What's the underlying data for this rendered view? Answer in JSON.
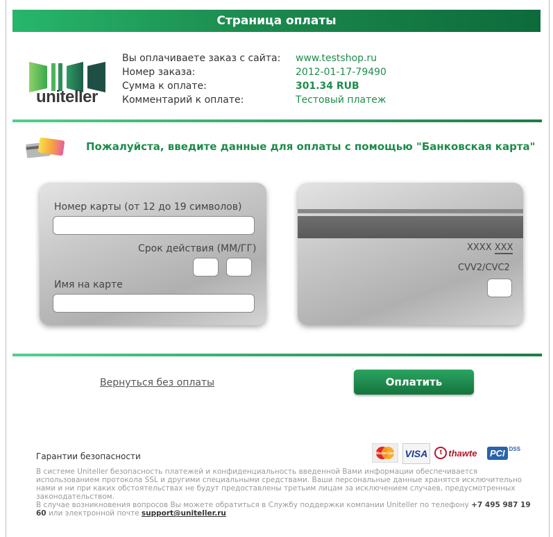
{
  "header": {
    "title": "Страница оплаты"
  },
  "logo": {
    "text": "uniteller"
  },
  "order": {
    "site_label": "Вы оплачиваете заказ с сайта:",
    "site_value": "www.testshop.ru",
    "number_label": "Номер заказа:",
    "number_value": "2012-01-17-79490",
    "amount_label": "Сумма к оплате:",
    "amount_value": "301.34 RUB",
    "comment_label": "Комментарий к оплате:",
    "comment_value": "Тестовый платеж"
  },
  "prompt": "Пожалуйста, введите данные для оплаты с помощью \"Банковская карта\"",
  "card_front": {
    "number_label": "Номер карты (от 12 до 19 символов)",
    "expiry_label": "Срок действия (ММ/ГГ)",
    "name_label": "Имя на карте"
  },
  "card_back": {
    "masked_prefix": "XXXX",
    "masked_suffix": "XXX",
    "cvv_label": "CVV2/CVC2"
  },
  "actions": {
    "back_label": "Вернуться без оплаты",
    "pay_label": "Оплатить"
  },
  "security": {
    "title": "Гарантии безопасности",
    "text1": "В системе Uniteller безопасность платежей и конфиденциальность введенной Вами информации обеспечивается использованием протокола SSL и другими специальными средствами. Ваши персональные данные хранятся исключительно нами и ни при каких обстоятельствах не будут предоставлены третьим лицам за исключением случаев, предусмотренных законодательством.",
    "text2_before": "В случае возникновения вопросов Вы можете обратиться в Службу поддержки компании Uniteller по телефону",
    "phone": "+7 495 987 19 60",
    "text2_middle": "или электронной почте",
    "email": "support@uniteller.ru"
  },
  "badges": {
    "mastercard": "MasterCard",
    "visa": "VISA",
    "thawte": "thawte",
    "pci": "PCI",
    "dss": "DSS"
  },
  "colors": {
    "brand_green": "#1f8c4c",
    "header_green": "#1c8a4e"
  }
}
